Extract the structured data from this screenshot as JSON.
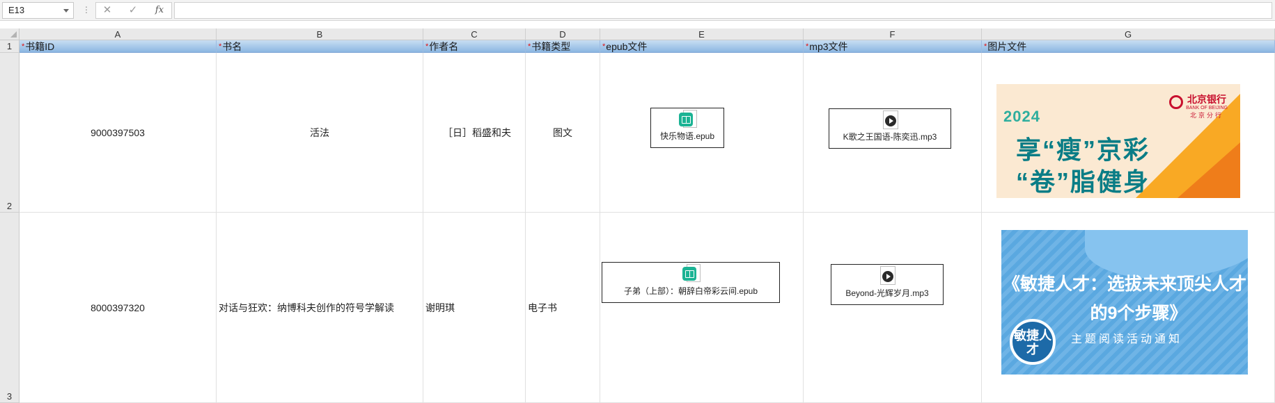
{
  "formula_bar": {
    "name_box": "E13",
    "separator": "⋮",
    "cancel_icon": "✕",
    "enter_icon": "✓",
    "fx_label": "fx",
    "formula": ""
  },
  "columns": [
    "A",
    "B",
    "C",
    "D",
    "E",
    "F",
    "G"
  ],
  "rows": [
    "1",
    "2",
    "3"
  ],
  "header": {
    "required_mark": "*",
    "cells": [
      "书籍ID",
      "书名",
      "作者名",
      "书籍类型",
      "epub文件",
      "mp3文件",
      "图片文件"
    ]
  },
  "data_rows": [
    {
      "book_id": "9000397503",
      "title": "活法",
      "author": "［日］稻盛和夫",
      "type": "图文",
      "epub_file": "快乐物语.epub",
      "mp3_file": "K歌之王国语-陈奕迅.mp3",
      "image": {
        "year": "2024",
        "line1": "享“瘦”京彩",
        "line2": "“卷”脂健身",
        "bank_name": "北京银行",
        "bank_en": "BANK OF BEIJING",
        "branch": "北京分行"
      }
    },
    {
      "book_id": "8000397320",
      "title": "对话与狂欢：纳博科夫创作的符号学解读",
      "author": "谢明琪",
      "type": "电子书",
      "epub_file": "子弟（上部）：朝辞白帝彩云间.epub",
      "mp3_file": "Beyond-光辉岁月.mp3",
      "image": {
        "line1": "《敏捷人才：选拔未来顶尖人才",
        "line2": "的9个步骤》",
        "subtitle": "主题阅读活动通知",
        "seal": "敏捷人才"
      }
    }
  ],
  "colors": {
    "header_top": "#c8def3",
    "header_bottom": "#8bb6e2",
    "required": "#e01010",
    "epub_badge": "#1bb394"
  }
}
